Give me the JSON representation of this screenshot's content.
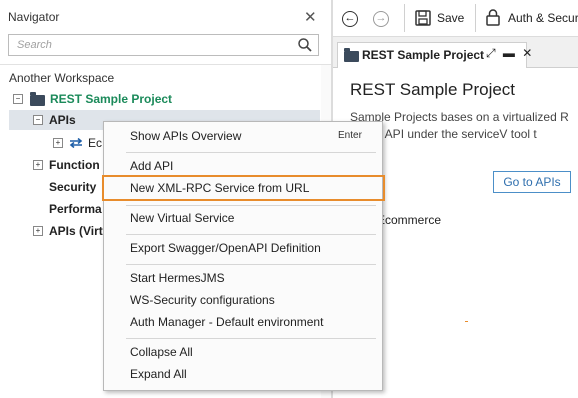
{
  "navigator": {
    "title": "Navigator",
    "close_glyph": "✕",
    "search_placeholder": "Search",
    "workspace": "Another Workspace",
    "project": "REST Sample Project",
    "apis": "APIs",
    "ecommerce_partial": "Ec",
    "functional": "Function",
    "security": "Security",
    "performance": "Performa",
    "apis_virt": "APIs (Virt"
  },
  "toolbar": {
    "back_glyph": "←",
    "forward_glyph": "→",
    "save_label": "Save",
    "auth_label": "Auth & Secur"
  },
  "tab": {
    "label": "REST Sample Project",
    "controls": "⤢ ▬ ✕"
  },
  "content": {
    "heading": "REST Sample Project",
    "desc_line1": "Sample Projects bases on a virtualized R",
    "desc_line2": "virtual API under the serviceV tool t",
    "partial_letter": "s",
    "goto_button": "Go to APIs",
    "ecommerce": "Ecommerce"
  },
  "menu": {
    "items": [
      {
        "label": "Show APIs Overview",
        "accel": "Enter"
      },
      {
        "label": "Add API"
      },
      {
        "label": "New XML-RPC Service from URL"
      },
      {
        "label": "New Virtual Service"
      },
      {
        "label": "Export Swagger/OpenAPI Definition"
      },
      {
        "label": "Start HermesJMS"
      },
      {
        "label": "WS-Security configurations"
      },
      {
        "label": "Auth Manager - Default environment"
      },
      {
        "label": "Collapse All"
      },
      {
        "label": "Expand All"
      }
    ]
  },
  "colors": {
    "project_green": "#1b8a5a",
    "highlight_orange": "#e88c2c",
    "link_blue": "#2f6fae",
    "arrow_blue": "#1f5fa8"
  }
}
